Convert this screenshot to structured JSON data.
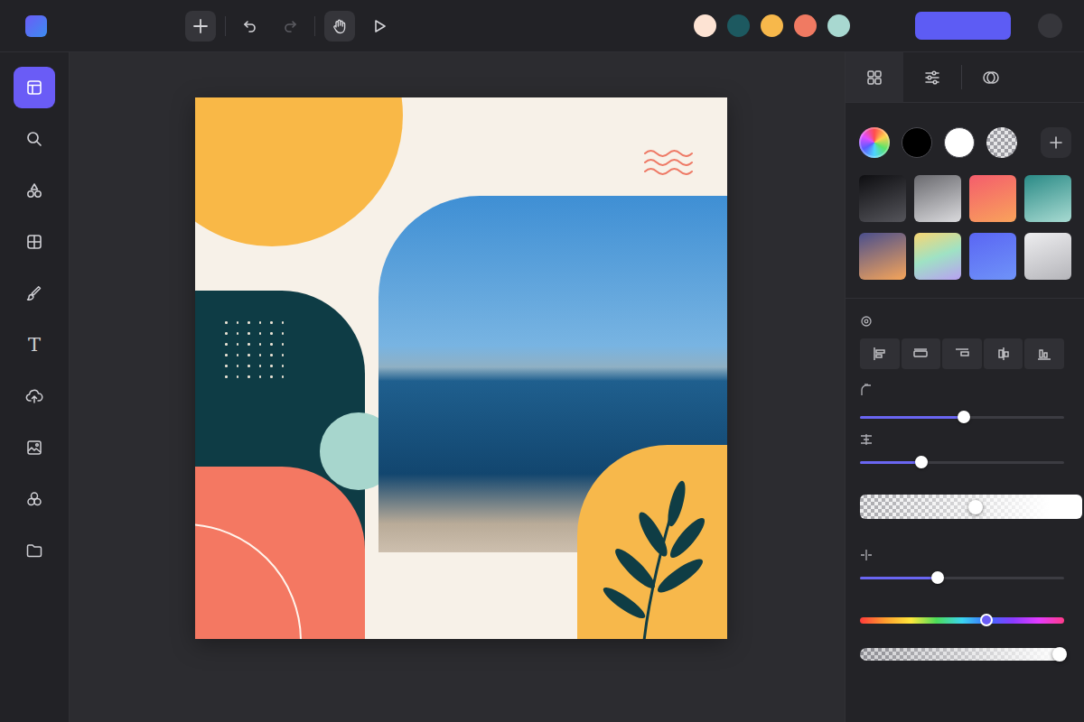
{
  "toolbar": [
    {
      "kind": "add",
      "selected": true,
      "disabled": false
    },
    {
      "kind": "undo",
      "selected": false,
      "disabled": false
    },
    {
      "kind": "redo",
      "selected": false,
      "disabled": true
    },
    {
      "kind": "hand",
      "selected": true,
      "disabled": false
    },
    {
      "kind": "play",
      "selected": false,
      "disabled": false
    }
  ],
  "header_swatches": [
    {
      "color": "#fde3d3"
    },
    {
      "color": "#1d5960"
    },
    {
      "color": "#f7b84b"
    },
    {
      "color": "#f07a62"
    },
    {
      "color": "#a8d8d0"
    }
  ],
  "sidebar": {
    "items": [
      {
        "kind": "layout",
        "selected": true
      },
      {
        "kind": "search",
        "selected": false
      },
      {
        "kind": "shapes",
        "selected": false
      },
      {
        "kind": "grid",
        "selected": false
      },
      {
        "kind": "brush",
        "selected": false
      },
      {
        "kind": "text",
        "glyph": "T",
        "selected": false
      },
      {
        "kind": "upload",
        "selected": false
      },
      {
        "kind": "image",
        "selected": false
      },
      {
        "kind": "elements",
        "selected": false
      },
      {
        "kind": "folder",
        "selected": false
      }
    ]
  },
  "panel": {
    "tabs": [
      {
        "kind": "presets",
        "selected": true
      },
      {
        "kind": "adjust",
        "selected": false
      },
      {
        "kind": "blend",
        "selected": false
      }
    ],
    "fills": [
      {
        "kind": "spectrum"
      },
      {
        "kind": "solid",
        "color": "#000000"
      },
      {
        "kind": "solid",
        "color": "#ffffff"
      },
      {
        "kind": "transparent"
      },
      {
        "kind": "add"
      }
    ],
    "gradients": [
      {
        "colors": [
          "#0e0e11",
          "#55555b"
        ]
      },
      {
        "colors": [
          "#6a6a6f",
          "#dadadd"
        ]
      },
      {
        "colors": [
          "#f45d6c",
          "#f9a35b"
        ]
      },
      {
        "colors": [
          "#2a8a86",
          "#a8dbd2"
        ]
      },
      {
        "colors": [
          "#4a4f8c",
          "#f6a55a"
        ]
      },
      {
        "colors": [
          "#f8d673",
          "#9fe2c4",
          "#b8a0f2"
        ]
      },
      {
        "colors": [
          "#5a66f4",
          "#6f93f8"
        ]
      },
      {
        "colors": [
          "#ededef",
          "#b5b5ba"
        ]
      }
    ],
    "align": [
      {
        "kind": "left",
        "selected": false
      },
      {
        "kind": "center",
        "selected": false
      },
      {
        "kind": "right",
        "selected": false
      },
      {
        "kind": "middle",
        "selected": false
      },
      {
        "kind": "bottom",
        "selected": false
      }
    ],
    "controls": [
      {
        "kind": "radius",
        "level": 0.51
      },
      {
        "kind": "spacing",
        "level": 0.3
      },
      {
        "kind": "fade",
        "level": 0.52
      },
      {
        "kind": "stroke",
        "level": 0.38
      },
      {
        "kind": "hue",
        "level": 0.62
      },
      {
        "kind": "alpha",
        "level": 0.98
      }
    ]
  }
}
